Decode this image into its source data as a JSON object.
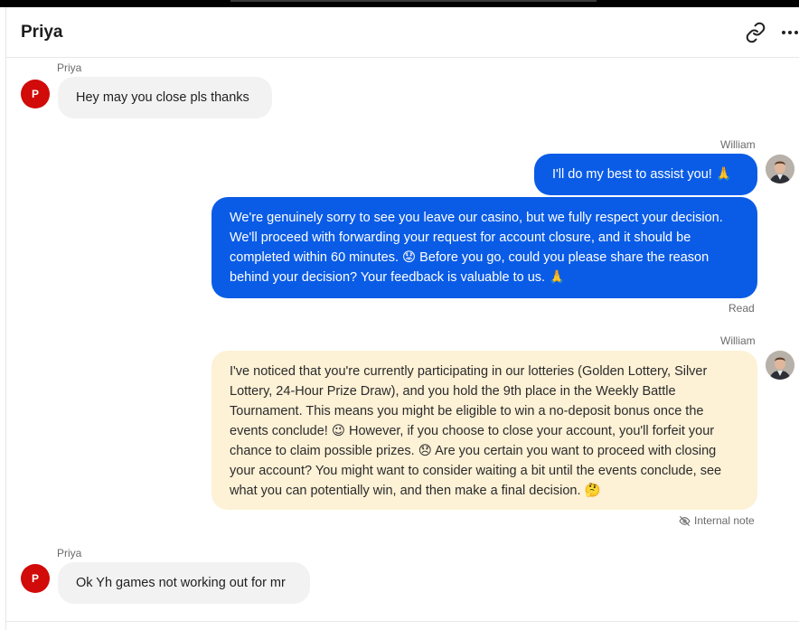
{
  "conversation": {
    "title": "Priya"
  },
  "header": {
    "link_icon": "link-icon",
    "more_icon": "more-options-icon"
  },
  "messages": [
    {
      "sender": "Priya",
      "avatar_initial": "P",
      "text": "Hey may you close pls thanks"
    },
    {
      "sender": "William",
      "text": "I'll do my best to assist you! 🙏"
    },
    {
      "text": "We're genuinely sorry to see you leave our casino, but we fully respect your decision. We'll proceed with forwarding your request for account closure, and it should be completed within 60 minutes. 😟 Before you go, could you please share the reason behind your decision? Your feedback is valuable to us. 🙏",
      "status": "Read"
    },
    {
      "sender": "William",
      "text": "I've noticed that you're currently participating in our lotteries (Golden Lottery, Silver Lottery, 24-Hour Prize Draw), and you hold the 9th place in the Weekly Battle Tournament. This means you might be eligible to win a no-deposit bonus once the events conclude! 😉 However, if you choose to close your account, you'll forfeit your chance to claim possible prizes. 😞 Are you certain you want to proceed with closing your account? You might want to consider waiting a bit until the events conclude, see what you can potentially win, and then make a final decision. 🤔",
      "status": "Internal note"
    },
    {
      "sender": "Priya",
      "avatar_initial": "P",
      "text": "Ok Yh games not working out for mr"
    }
  ],
  "colors": {
    "agent_bubble": "#0a5ce6",
    "customer_bubble": "#f2f2f3",
    "internal_note_bubble": "#fdf1d6",
    "customer_avatar": "#d10a0a"
  }
}
